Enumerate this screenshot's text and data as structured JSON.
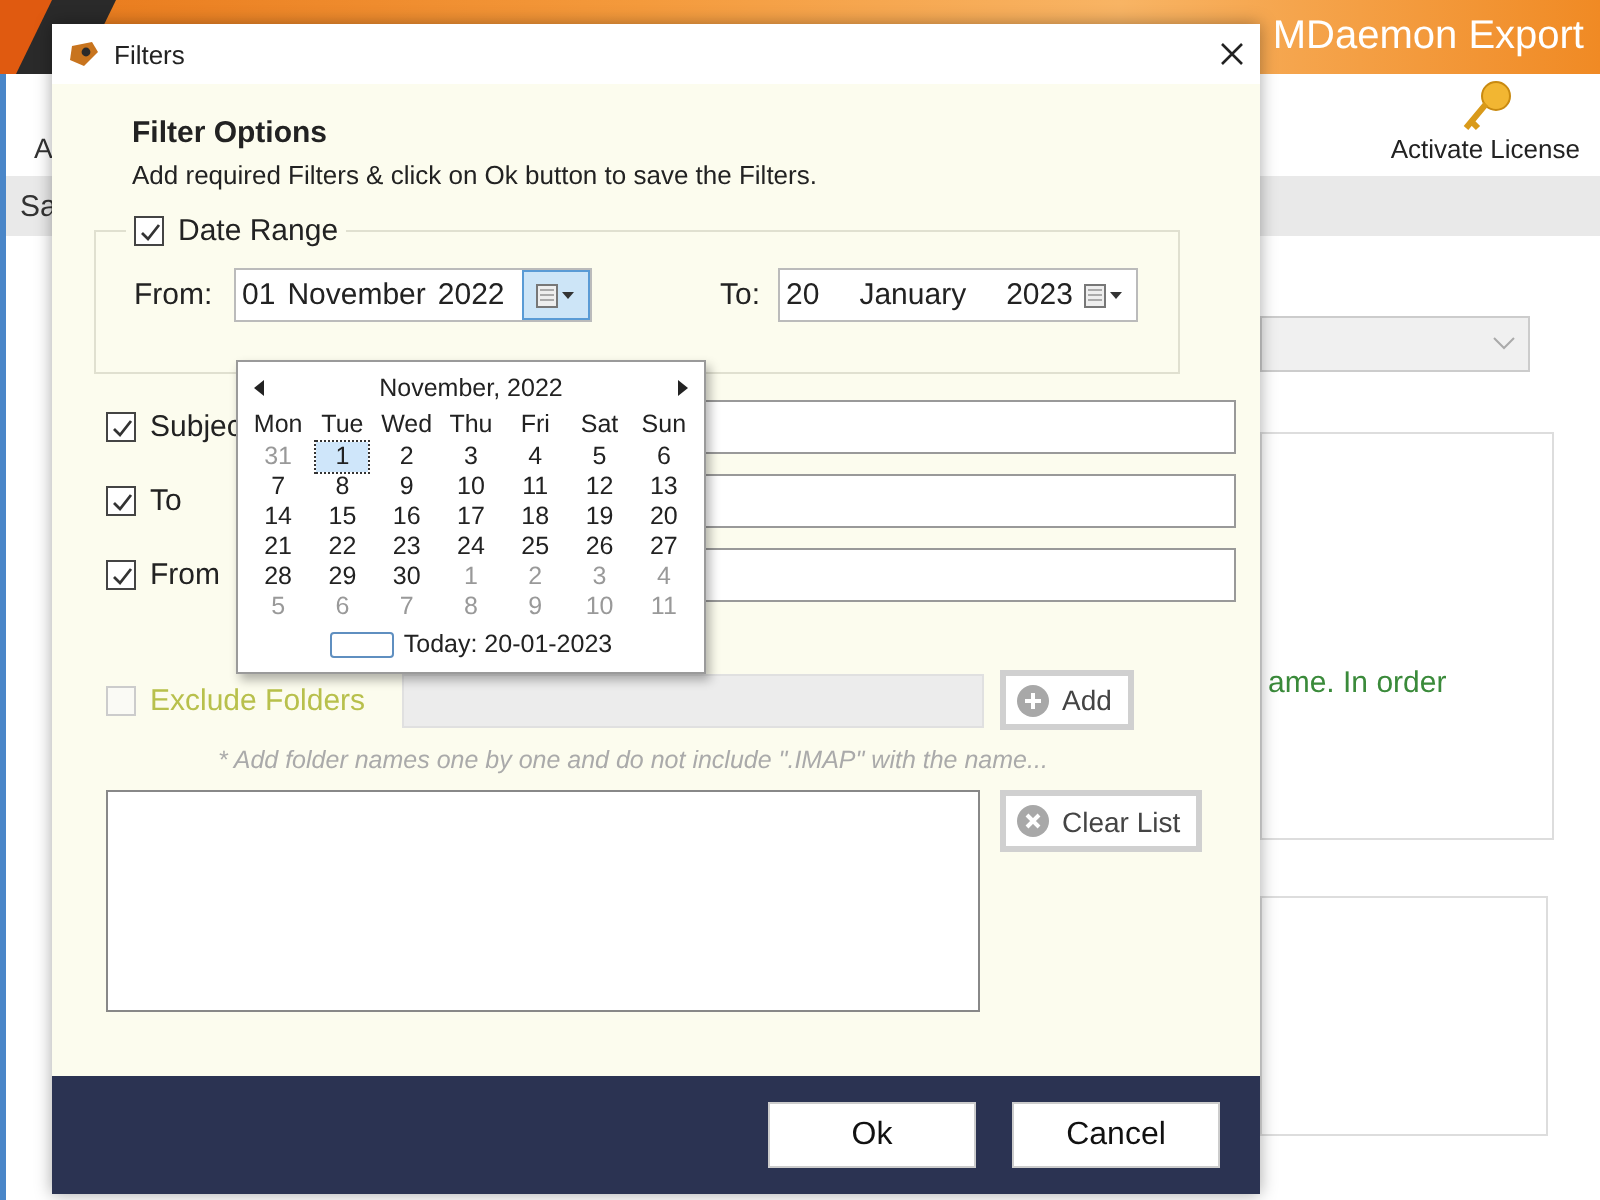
{
  "app": {
    "title": "MDaemon Export",
    "toolbar_left": "A",
    "toolbar_right": "Activate License",
    "tab_fragment": "Sa",
    "message_fragment": "ame. In order"
  },
  "dialog": {
    "title": "Filters",
    "heading": "Filter Options",
    "subtitle": "Add required Filters & click on Ok button to save the Filters.",
    "date_range": {
      "label": "Date Range",
      "checked": true,
      "from_label": "From:",
      "to_label": "To:",
      "from": {
        "parts": [
          "01",
          "November",
          "2022"
        ],
        "open": true
      },
      "to": {
        "parts": [
          "20",
          "January",
          "2023"
        ],
        "open": false
      }
    },
    "filters": [
      {
        "label": "Subjec",
        "checked": true
      },
      {
        "label": "To",
        "checked": true
      },
      {
        "label": "From",
        "checked": true
      }
    ],
    "exclude": {
      "label": "Exclude Folders",
      "checked": false,
      "disabled": true,
      "button": "Add",
      "hint": "* Add folder names one by one and do not include \".IMAP\" with the name..."
    },
    "clear_button": "Clear List",
    "buttons": [
      {
        "label": "Ok"
      },
      {
        "label": "Cancel"
      }
    ]
  },
  "calendar": {
    "month": "November, 2022",
    "weekdays": [
      "Mon",
      "Tue",
      "Wed",
      "Thu",
      "Fri",
      "Sat",
      "Sun"
    ],
    "weeks": [
      [
        {
          "day": "31",
          "other_month": true,
          "selected": false
        },
        {
          "day": "1",
          "other_month": false,
          "selected": true
        },
        {
          "day": "2",
          "other_month": false,
          "selected": false
        },
        {
          "day": "3",
          "other_month": false,
          "selected": false
        },
        {
          "day": "4",
          "other_month": false,
          "selected": false
        },
        {
          "day": "5",
          "other_month": false,
          "selected": false
        },
        {
          "day": "6",
          "other_month": false,
          "selected": false
        }
      ],
      [
        {
          "day": "7",
          "other_month": false,
          "selected": false
        },
        {
          "day": "8",
          "other_month": false,
          "selected": false
        },
        {
          "day": "9",
          "other_month": false,
          "selected": false
        },
        {
          "day": "10",
          "other_month": false,
          "selected": false
        },
        {
          "day": "11",
          "other_month": false,
          "selected": false
        },
        {
          "day": "12",
          "other_month": false,
          "selected": false
        },
        {
          "day": "13",
          "other_month": false,
          "selected": false
        }
      ],
      [
        {
          "day": "14",
          "other_month": false,
          "selected": false
        },
        {
          "day": "15",
          "other_month": false,
          "selected": false
        },
        {
          "day": "16",
          "other_month": false,
          "selected": false
        },
        {
          "day": "17",
          "other_month": false,
          "selected": false
        },
        {
          "day": "18",
          "other_month": false,
          "selected": false
        },
        {
          "day": "19",
          "other_month": false,
          "selected": false
        },
        {
          "day": "20",
          "other_month": false,
          "selected": false
        }
      ],
      [
        {
          "day": "21",
          "other_month": false,
          "selected": false
        },
        {
          "day": "22",
          "other_month": false,
          "selected": false
        },
        {
          "day": "23",
          "other_month": false,
          "selected": false
        },
        {
          "day": "24",
          "other_month": false,
          "selected": false
        },
        {
          "day": "25",
          "other_month": false,
          "selected": false
        },
        {
          "day": "26",
          "other_month": false,
          "selected": false
        },
        {
          "day": "27",
          "other_month": false,
          "selected": false
        }
      ],
      [
        {
          "day": "28",
          "other_month": false,
          "selected": false
        },
        {
          "day": "29",
          "other_month": false,
          "selected": false
        },
        {
          "day": "30",
          "other_month": false,
          "selected": false
        },
        {
          "day": "1",
          "other_month": true,
          "selected": false
        },
        {
          "day": "2",
          "other_month": true,
          "selected": false
        },
        {
          "day": "3",
          "other_month": true,
          "selected": false
        },
        {
          "day": "4",
          "other_month": true,
          "selected": false
        }
      ],
      [
        {
          "day": "5",
          "other_month": true,
          "selected": false
        },
        {
          "day": "6",
          "other_month": true,
          "selected": false
        },
        {
          "day": "7",
          "other_month": true,
          "selected": false
        },
        {
          "day": "8",
          "other_month": true,
          "selected": false
        },
        {
          "day": "9",
          "other_month": true,
          "selected": false
        },
        {
          "day": "10",
          "other_month": true,
          "selected": false
        },
        {
          "day": "11",
          "other_month": true,
          "selected": false
        }
      ]
    ],
    "today": "Today: 20-01-2023"
  }
}
